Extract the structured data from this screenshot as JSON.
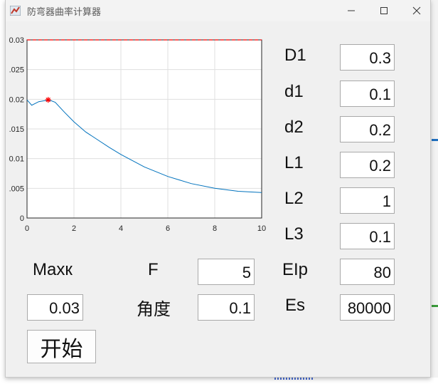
{
  "window": {
    "title": "防弯器曲率计算器",
    "minimize": "—",
    "maximize": "☐",
    "close": "✕"
  },
  "params": [
    {
      "label": "D1",
      "value": "0.3"
    },
    {
      "label": "d1",
      "value": "0.1"
    },
    {
      "label": "d2",
      "value": "0.2"
    },
    {
      "label": "L1",
      "value": "0.2"
    },
    {
      "label": "L2",
      "value": "1"
    },
    {
      "label": "L3",
      "value": "0.1"
    },
    {
      "label": "EIp",
      "value": "80"
    },
    {
      "label": "Es",
      "value": "80000"
    }
  ],
  "left_params": {
    "maxk_label": "Maxк",
    "maxk_value": "0.03",
    "f_label": "F",
    "f_value": "5",
    "angle_label": "角度",
    "angle_value": "0.1"
  },
  "start_button": "开始",
  "chart_data": {
    "type": "line",
    "title": "",
    "xlabel": "",
    "ylabel": "",
    "xlim": [
      0,
      10
    ],
    "ylim": [
      0,
      0.03
    ],
    "xticks": [
      "0",
      "2",
      "4",
      "6",
      "8",
      "10"
    ],
    "yticks": [
      "0",
      ".005",
      "0.01",
      ".015",
      "0.02",
      ".025",
      "0.03"
    ],
    "grid": true,
    "series": [
      {
        "color": "#0072bd",
        "x": [
          0,
          0.2,
          0.5,
          0.8,
          1.0,
          1.2,
          1.6,
          2.0,
          2.5,
          3.0,
          3.5,
          4.0,
          5.0,
          6.0,
          7.0,
          8.0,
          9.0,
          10.0
        ],
        "y": [
          0.0199,
          0.019,
          0.0196,
          0.0198,
          0.0198,
          0.0195,
          0.0178,
          0.0162,
          0.0145,
          0.0132,
          0.0119,
          0.0107,
          0.0086,
          0.007,
          0.0058,
          0.005,
          0.0045,
          0.0043
        ]
      }
    ],
    "marker": {
      "x": 0.9,
      "y": 0.0199,
      "symbol": "*",
      "color": "#ff0000"
    },
    "reference_line": {
      "y": 0.03,
      "style": "dashed",
      "color": "#ff0000"
    }
  }
}
